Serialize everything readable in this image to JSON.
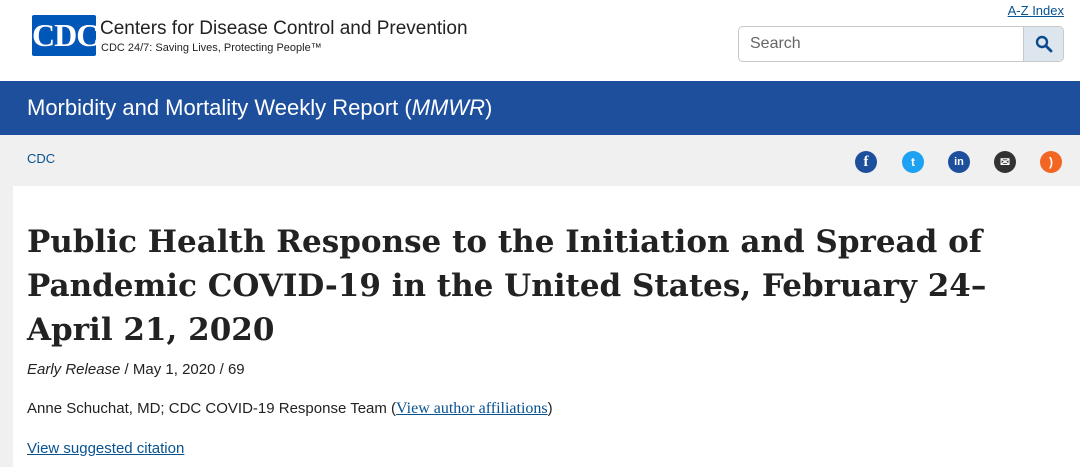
{
  "header": {
    "logo_text": "CDC",
    "org_name": "Centers for Disease Control and Prevention",
    "tagline": "CDC 24/7: Saving Lives, Protecting People™",
    "az_index": "A-Z Index",
    "search_placeholder": "Search",
    "search_icon": "search-icon"
  },
  "banner": {
    "title_main": "Morbidity and Mortality Weekly Report (",
    "title_italic": "MMWR",
    "title_end": ")"
  },
  "breadcrumb": {
    "item": "CDC"
  },
  "social": [
    {
      "name": "facebook-icon",
      "glyph": "f",
      "color": "#1d4f9c"
    },
    {
      "name": "twitter-icon",
      "glyph": "t",
      "color": "#1da1f2"
    },
    {
      "name": "linkedin-icon",
      "glyph": "in",
      "color": "#1d4f9c"
    },
    {
      "name": "email-icon",
      "glyph": "✉",
      "color": "#333333"
    },
    {
      "name": "rss-icon",
      "glyph": ")",
      "color": "#f26522"
    }
  ],
  "article": {
    "title": "Public Health Response to the Initiation and Spread of Pandemic COVID-19 in the United States, February 24–April 21, 2020",
    "release_label": "Early Release",
    "release_rest": " / May 1, 2020 / 69",
    "authors": "Anne Schuchat, MD; CDC COVID-19 Response Team (",
    "affiliations_link": "View author affiliations",
    "authors_end": ")",
    "citation_link": "View suggested citation"
  }
}
